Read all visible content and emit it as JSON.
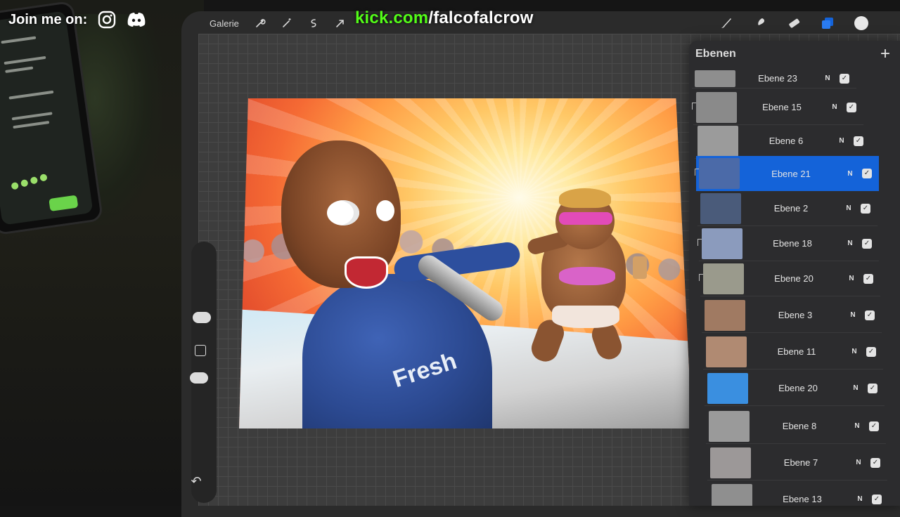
{
  "overlay": {
    "join_text": "Join me on:",
    "social": [
      {
        "icon": "instagram-icon"
      },
      {
        "icon": "discord-icon"
      }
    ],
    "kick_domain": "kick.com",
    "kick_path": "/falcofalcrow"
  },
  "toolbar": {
    "gallery_label": "Galerie",
    "left_icons": [
      "wrench-icon",
      "magic-wand-icon",
      "selection-icon",
      "transform-arrow-icon"
    ],
    "right_tools": [
      "brush-icon",
      "smudge-icon",
      "eraser-icon",
      "layers-icon",
      "color-icon"
    ],
    "active_color": "#1463d9"
  },
  "artwork": {
    "hoodie_text": "Fresh"
  },
  "layers": {
    "title": "Ebenen",
    "add_label": "+",
    "items": [
      {
        "name": "Ebene 23",
        "mode": "N",
        "visible": true,
        "selected": false,
        "clipped": false,
        "thumb": "#8e8e8e"
      },
      {
        "name": "Ebene 15",
        "mode": "N",
        "visible": true,
        "selected": false,
        "clipped": true,
        "thumb": "#8a8a8a"
      },
      {
        "name": "Ebene 6",
        "mode": "N",
        "visible": true,
        "selected": false,
        "clipped": false,
        "thumb": "#9b9b9b"
      },
      {
        "name": "Ebene 21",
        "mode": "N",
        "visible": true,
        "selected": true,
        "clipped": true,
        "thumb": "#4b6aa8"
      },
      {
        "name": "Ebene 2",
        "mode": "N",
        "visible": true,
        "selected": false,
        "clipped": false,
        "thumb": "#4a5b7a"
      },
      {
        "name": "Ebene 18",
        "mode": "N",
        "visible": true,
        "selected": false,
        "clipped": true,
        "thumb": "#8b9bbd"
      },
      {
        "name": "Ebene 20",
        "mode": "N",
        "visible": true,
        "selected": false,
        "clipped": true,
        "thumb": "#9a9a8c"
      },
      {
        "name": "Ebene 3",
        "mode": "N",
        "visible": true,
        "selected": false,
        "clipped": false,
        "thumb": "#a07a62"
      },
      {
        "name": "Ebene 11",
        "mode": "N",
        "visible": true,
        "selected": false,
        "clipped": false,
        "thumb": "#b08a72"
      },
      {
        "name": "Ebene 20",
        "mode": "N",
        "visible": true,
        "selected": false,
        "clipped": false,
        "thumb": "#3a8fe0"
      },
      {
        "name": "Ebene 8",
        "mode": "N",
        "visible": true,
        "selected": false,
        "clipped": false,
        "thumb": "#9a9a9a"
      },
      {
        "name": "Ebene 7",
        "mode": "N",
        "visible": true,
        "selected": false,
        "clipped": false,
        "thumb": "#9c9898"
      },
      {
        "name": "Ebene 13",
        "mode": "N",
        "visible": true,
        "selected": false,
        "clipped": false,
        "thumb": "#8f8f8f"
      }
    ]
  }
}
